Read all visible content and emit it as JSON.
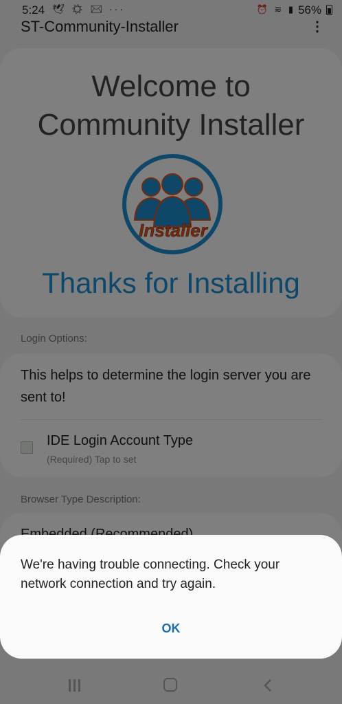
{
  "status_bar": {
    "time": "5:24",
    "left_icons": [
      "dove-icon",
      "sunrise-icon",
      "gmail-icon",
      "more-dots-icon"
    ],
    "right_icons": [
      "alarm-icon",
      "wifi-icon",
      "signal-icon"
    ],
    "battery_text": "56%"
  },
  "app_bar": {
    "title": "ST-Community-Installer"
  },
  "welcome": {
    "title_line1": "Welcome to",
    "title_line2": "Community Installer",
    "logo_text": "Installer",
    "thanks": "Thanks for Installing"
  },
  "login": {
    "section_label": "Login Options:",
    "description": "This helps to determine the login server you are sent to!",
    "account_type_title": "IDE Login Account Type",
    "account_type_sub": "(Required) Tap to set"
  },
  "browser": {
    "section_label": "Browser Type Description:",
    "option": "Embedded (Recommended)"
  },
  "dialog": {
    "message": "We're having trouble connecting. Check your network connection and try again.",
    "ok_label": "OK"
  },
  "colors": {
    "accent": "#1d8fd0",
    "dialog_button": "#1a6fb0",
    "logo_orange": "#e5541e"
  }
}
